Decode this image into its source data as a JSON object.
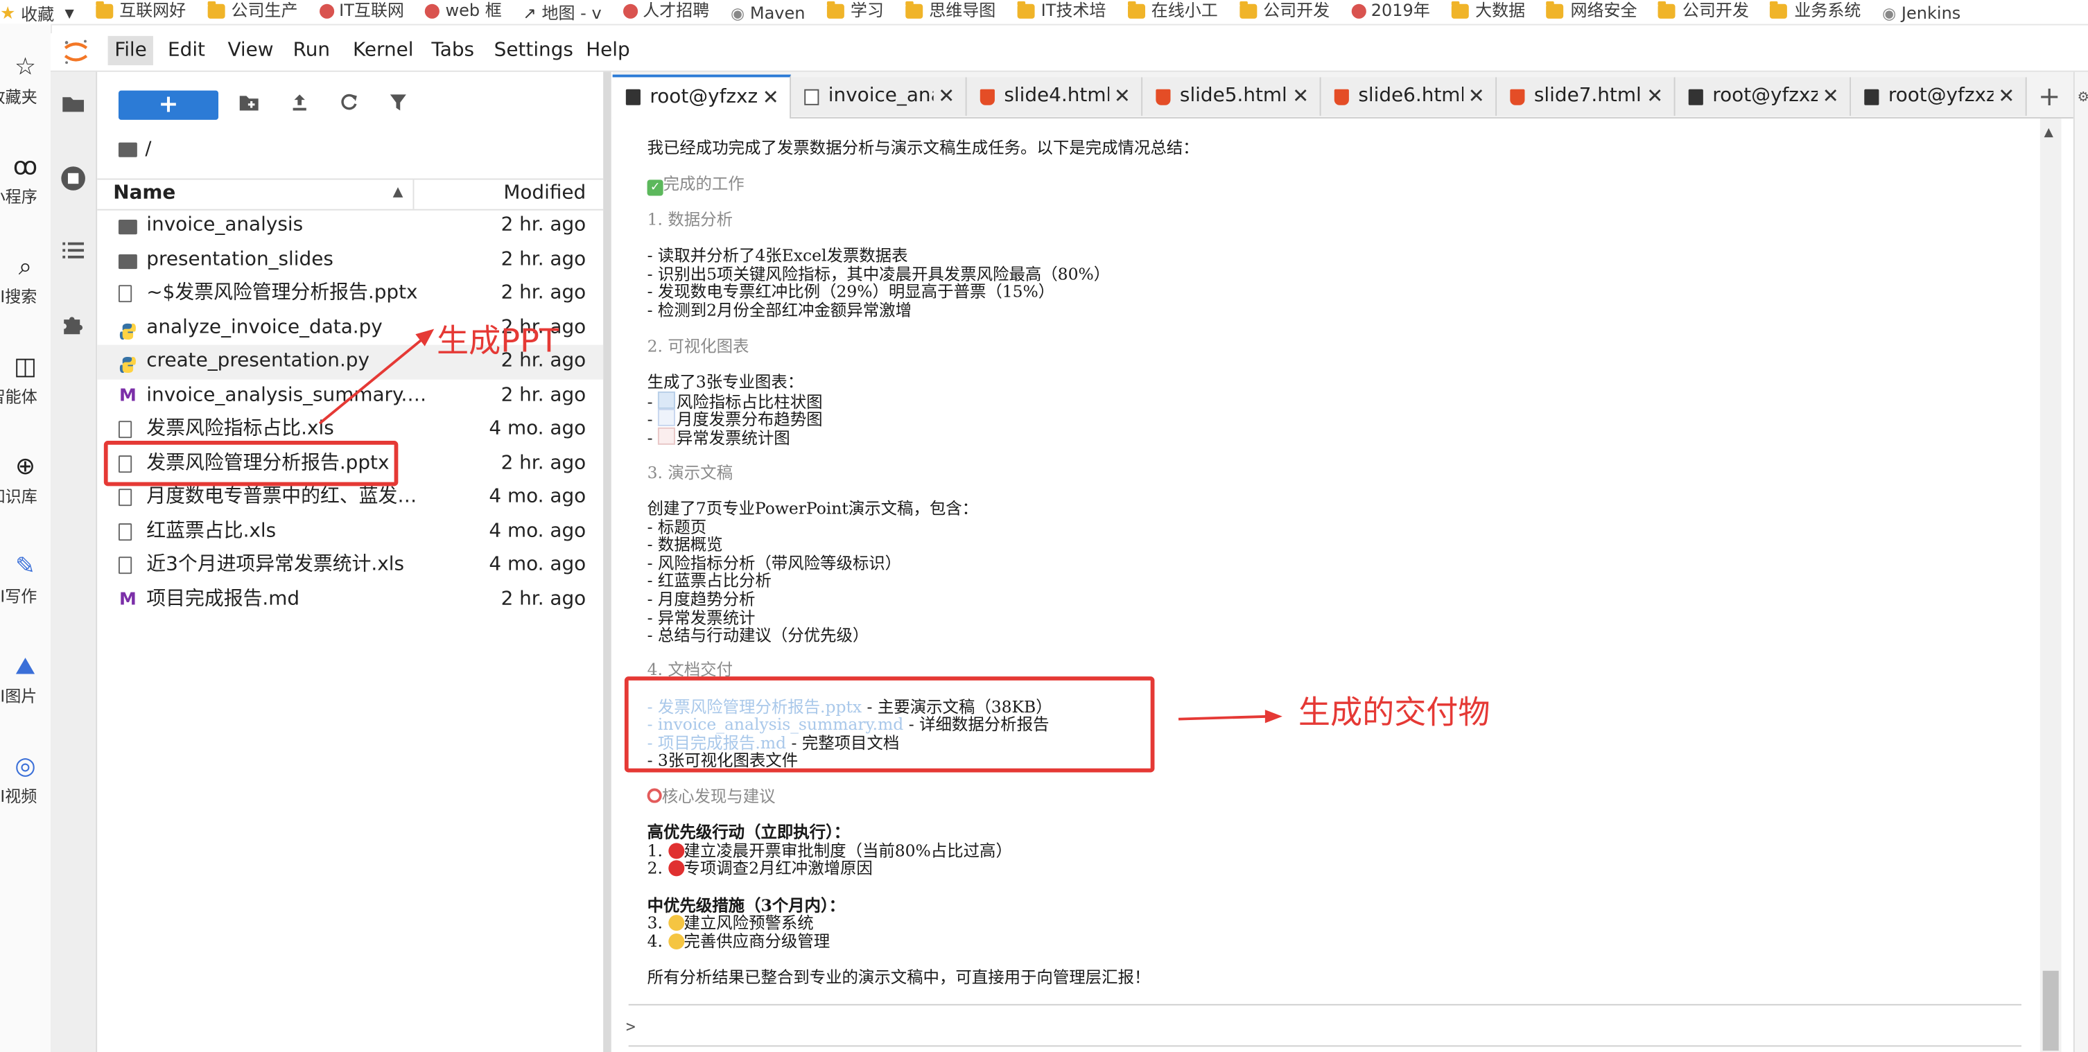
{
  "bookmarks": [
    {
      "label": "收藏",
      "icon": "star-icon"
    },
    {
      "label": "互联网好",
      "icon": "folder-icon"
    },
    {
      "label": "公司生产",
      "icon": "folder-icon"
    },
    {
      "label": "IT互联网",
      "icon": "site-icon"
    },
    {
      "label": "web 框",
      "icon": "site-icon"
    },
    {
      "label": "地图 - v",
      "icon": "chart-icon"
    },
    {
      "label": "人才招聘",
      "icon": "site-icon"
    },
    {
      "label": "Maven",
      "icon": "globe-icon"
    },
    {
      "label": "学习",
      "icon": "folder-icon"
    },
    {
      "label": "思维导图",
      "icon": "folder-icon"
    },
    {
      "label": "IT技术培",
      "icon": "folder-icon"
    },
    {
      "label": "在线小工",
      "icon": "folder-icon"
    },
    {
      "label": "公司开发",
      "icon": "folder-icon"
    },
    {
      "label": "2019年",
      "icon": "site-icon"
    },
    {
      "label": "大数据",
      "icon": "folder-icon"
    },
    {
      "label": "网络安全",
      "icon": "folder-icon"
    },
    {
      "label": "公司开发",
      "icon": "folder-icon"
    },
    {
      "label": "业务系统",
      "icon": "folder-icon"
    },
    {
      "label": "Jenkins",
      "icon": "globe-icon"
    }
  ],
  "rail": [
    {
      "label": "收藏夹",
      "icon": "star-icon"
    },
    {
      "label": "小程序",
      "icon": "mini-program-icon"
    },
    {
      "label": "AI搜索",
      "icon": "search-icon"
    },
    {
      "label": "智能体",
      "icon": "agent-icon"
    },
    {
      "label": "知识库",
      "icon": "knowledge-icon"
    },
    {
      "label": "AI写作",
      "icon": "write-icon"
    },
    {
      "label": "AI图片",
      "icon": "image-icon"
    },
    {
      "label": "AI视频",
      "icon": "video-icon"
    }
  ],
  "menu": [
    "File",
    "Edit",
    "View",
    "Run",
    "Kernel",
    "Tabs",
    "Settings",
    "Help"
  ],
  "filebrowser": {
    "new_label": "+",
    "path": "/",
    "col_name": "Name",
    "col_modified": "Modified",
    "files": [
      {
        "name": "invoice_analysis",
        "type": "folder",
        "modified": "2 hr. ago"
      },
      {
        "name": "presentation_slides",
        "type": "folder",
        "modified": "2 hr. ago"
      },
      {
        "name": "~$发票风险管理分析报告.pptx",
        "type": "file",
        "modified": "2 hr. ago"
      },
      {
        "name": "analyze_invoice_data.py",
        "type": "python",
        "modified": "2 hr. ago"
      },
      {
        "name": "create_presentation.py",
        "type": "python",
        "modified": "2 hr. ago"
      },
      {
        "name": "invoice_analysis_summary.md",
        "type": "markdown",
        "modified": "2 hr. ago"
      },
      {
        "name": "发票风险指标占比.xls",
        "type": "file",
        "modified": "4 mo. ago"
      },
      {
        "name": "发票风险管理分析报告.pptx",
        "type": "file",
        "modified": "2 hr. ago"
      },
      {
        "name": "月度数电专普票中的红、蓝发票...",
        "type": "file",
        "modified": "4 mo. ago"
      },
      {
        "name": "红蓝票占比.xls",
        "type": "file",
        "modified": "4 mo. ago"
      },
      {
        "name": "近3个月进项异常发票统计.xls",
        "type": "file",
        "modified": "4 mo. ago"
      },
      {
        "name": "项目完成报告.md",
        "type": "markdown",
        "modified": "2 hr. ago"
      }
    ]
  },
  "tabs": [
    {
      "label": "root@yfzxzh",
      "type": "terminal"
    },
    {
      "label": "invoice_anal",
      "type": "document"
    },
    {
      "label": "slide4.html",
      "type": "html"
    },
    {
      "label": "slide5.html",
      "type": "html"
    },
    {
      "label": "slide6.html",
      "type": "html"
    },
    {
      "label": "slide7.html",
      "type": "html"
    },
    {
      "label": "root@yfzxzh",
      "type": "terminal"
    },
    {
      "label": "root@yfzxzh",
      "type": "terminal"
    }
  ],
  "terminal": {
    "intro": "我已经成功完成了发票数据分析与演示文稿生成任务。以下是完成情况总结：",
    "h_done": "完成的工作",
    "h1": "1. 数据分析",
    "s1": [
      "- 读取并分析了4张Excel发票数据表",
      "- 识别出5项关键风险指标，其中凌晨开具发票风险最高（80%）",
      "- 发现数电专票红冲比例（29%）明显高于普票（15%）",
      "- 检测到2月份全部红冲金额异常激增"
    ],
    "h2": "2. 可视化图表",
    "s2_intro": "生成了3张专业图表：",
    "s2": [
      "风险指标占比柱状图",
      "月度发票分布趋势图",
      "异常发票统计图"
    ],
    "h3": "3. 演示文稿",
    "s3_intro": "创建了7页专业PowerPoint演示文稿，包含：",
    "s3": [
      "- 标题页",
      "- 数据概览",
      "- 风险指标分析（带风险等级标识）",
      "- 红蓝票占比分析",
      "- 月度趋势分析",
      "- 异常发票统计",
      "- 总结与行动建议（分优先级）"
    ],
    "h4": "4. 文档交付",
    "deliv": [
      {
        "link": "发票风险管理分析报告.pptx",
        "desc": " - 主要演示文稿（38KB）"
      },
      {
        "link": "invoice_analysis_summary.md",
        "desc": " - 详细数据分析报告"
      },
      {
        "link": "项目完成报告.md",
        "desc": " - 完整项目文档"
      }
    ],
    "deliv_last": "- 3张可视化图表文件",
    "h_core": "核心发现与建议",
    "high_title": "高优先级行动（立即执行）：",
    "high": [
      {
        "num": "1. ",
        "text": "建立凌晨开票审批制度（当前80%占比过高）"
      },
      {
        "num": "2. ",
        "text": "专项调查2月红冲激增原因"
      }
    ],
    "mid_title": "中优先级措施（3个月内）：",
    "mid": [
      {
        "num": "3. ",
        "text": "建立风险预警系统"
      },
      {
        "num": "4. ",
        "text": "完善供应商分级管理"
      }
    ],
    "final": "所有分析结果已整合到专业的演示文稿中，可直接用于向管理层汇报！",
    "prompt": ">"
  },
  "annotations": {
    "ppt_label": "生成PPT",
    "deliv_label": "生成的交付物",
    "color": "#e53935"
  }
}
